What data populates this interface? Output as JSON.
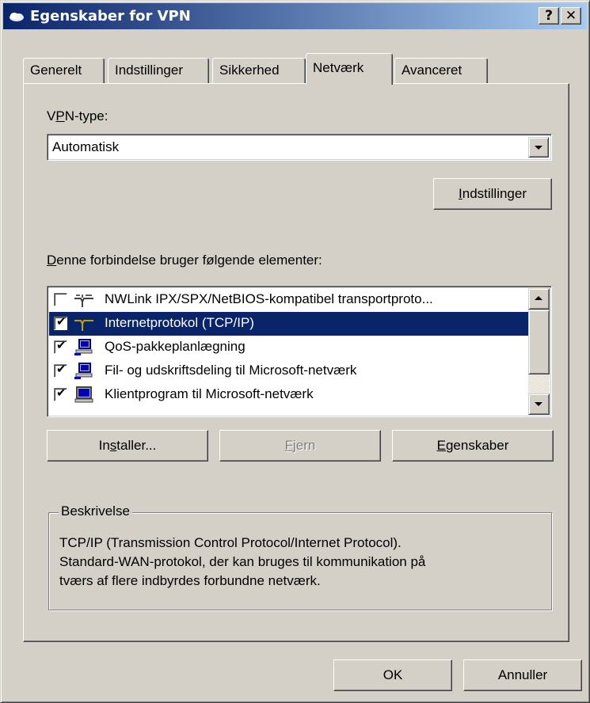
{
  "window": {
    "title": "Egenskaber for VPN",
    "help_label": "?",
    "close_label": "✕"
  },
  "tabs": [
    {
      "label": "Generelt",
      "active": false
    },
    {
      "label": "Indstillinger",
      "active": false
    },
    {
      "label": "Sikkerhed",
      "active": false
    },
    {
      "label": "Netværk",
      "active": true
    },
    {
      "label": "Avanceret",
      "active": false
    }
  ],
  "vpn_type": {
    "label_pre": "V",
    "label_u": "P",
    "label_post": "N-type:",
    "value": "Automatisk"
  },
  "settings_button": {
    "u": "I",
    "rest": "ndstillinger"
  },
  "components": {
    "label_u": "D",
    "label_rest": "enne forbindelse bruger følgende elementer:",
    "items": [
      {
        "label": "NWLink IPX/SPX/NetBIOS-kompatibel transportproto...",
        "checked": false,
        "selected": false,
        "icon": "protocol-icon"
      },
      {
        "label": "Internetprotokol (TCP/IP)",
        "checked": true,
        "selected": true,
        "icon": "protocol-icon"
      },
      {
        "label": "QoS-pakkeplanlægning",
        "checked": true,
        "selected": false,
        "icon": "service-icon"
      },
      {
        "label": "Fil- og udskriftsdeling til Microsoft-netværk",
        "checked": true,
        "selected": false,
        "icon": "service-icon"
      },
      {
        "label": "Klientprogram til Microsoft-netværk",
        "checked": true,
        "selected": false,
        "icon": "client-icon"
      }
    ]
  },
  "buttons": {
    "install": {
      "pre": "In",
      "u": "s",
      "post": "taller..."
    },
    "remove": {
      "pre": "",
      "u": "F",
      "post": "jern"
    },
    "properties": {
      "pre": "",
      "u": "E",
      "post": "genskaber"
    },
    "ok": "OK",
    "cancel": "Annuller"
  },
  "description": {
    "legend": "Beskrivelse",
    "text": "TCP/IP (Transmission Control Protocol/Internet Protocol).\nStandard-WAN-protokol, der kan bruges til kommunikation på\ntværs af flere indbyrdes forbundne netværk."
  },
  "colors": {
    "title_start": "#0a246a",
    "title_end": "#a6caf0",
    "selection": "#0a246a",
    "face": "#d4d0c8"
  }
}
